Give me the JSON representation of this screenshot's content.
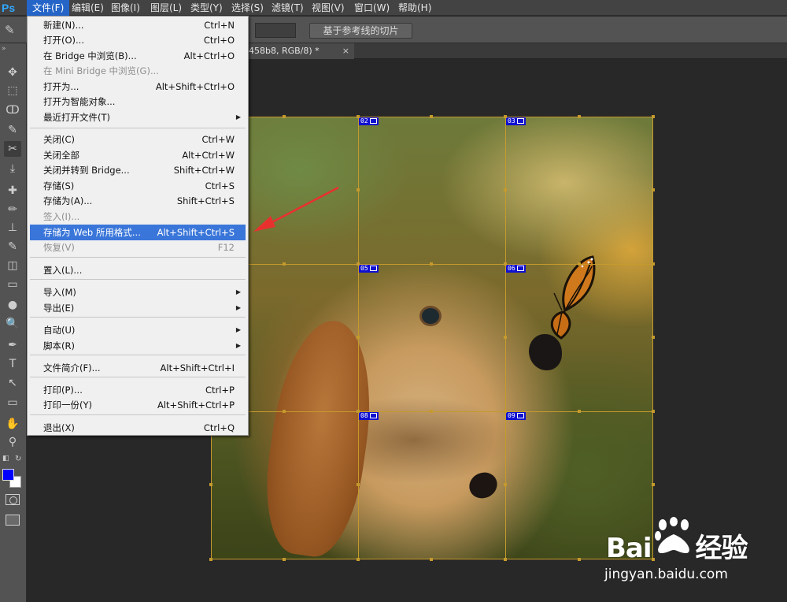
{
  "app": {
    "logo": "Ps"
  },
  "menubar": [
    {
      "label": "文件(F)",
      "active": true
    },
    {
      "label": "编辑(E)"
    },
    {
      "label": "图像(I)"
    },
    {
      "label": "图层(L)"
    },
    {
      "label": "类型(Y)"
    },
    {
      "label": "选择(S)"
    },
    {
      "label": "滤镜(T)"
    },
    {
      "label": "视图(V)"
    },
    {
      "label": "窗口(W)"
    },
    {
      "label": "帮助(H)"
    }
  ],
  "options_bar": {
    "guides_button": "基于参考线的切片"
  },
  "document_tab": {
    "title": "458b8, RGB/8) *",
    "close": "×"
  },
  "file_menu": {
    "items": [
      {
        "label": "新建(N)...",
        "shortcut": "Ctrl+N"
      },
      {
        "label": "打开(O)...",
        "shortcut": "Ctrl+O"
      },
      {
        "label": "在 Bridge 中浏览(B)...",
        "shortcut": "Alt+Ctrl+O"
      },
      {
        "label": "在 Mini Bridge 中浏览(G)...",
        "shortcut": "",
        "disabled": true
      },
      {
        "label": "打开为...",
        "shortcut": "Alt+Shift+Ctrl+O"
      },
      {
        "label": "打开为智能对象...",
        "shortcut": ""
      },
      {
        "label": "最近打开文件(T)",
        "shortcut": "",
        "submenu": true
      },
      {
        "label": "关闭(C)",
        "shortcut": "Ctrl+W"
      },
      {
        "label": "关闭全部",
        "shortcut": "Alt+Ctrl+W"
      },
      {
        "label": "关闭并转到 Bridge...",
        "shortcut": "Shift+Ctrl+W"
      },
      {
        "label": "存储(S)",
        "shortcut": "Ctrl+S"
      },
      {
        "label": "存储为(A)...",
        "shortcut": "Shift+Ctrl+S"
      },
      {
        "label": "签入(I)...",
        "shortcut": "",
        "disabled": true
      },
      {
        "label": "存储为 Web 所用格式...",
        "shortcut": "Alt+Shift+Ctrl+S",
        "highlighted": true
      },
      {
        "label": "恢复(V)",
        "shortcut": "F12",
        "disabled": true
      },
      {
        "label": "置入(L)...",
        "shortcut": ""
      },
      {
        "label": "导入(M)",
        "shortcut": "",
        "submenu": true
      },
      {
        "label": "导出(E)",
        "shortcut": "",
        "submenu": true
      },
      {
        "label": "自动(U)",
        "shortcut": "",
        "submenu": true
      },
      {
        "label": "脚本(R)",
        "shortcut": "",
        "submenu": true
      },
      {
        "label": "文件简介(F)...",
        "shortcut": "Alt+Shift+Ctrl+I"
      },
      {
        "label": "打印(P)...",
        "shortcut": "Ctrl+P"
      },
      {
        "label": "打印一份(Y)",
        "shortcut": "Alt+Shift+Ctrl+P"
      },
      {
        "label": "退出(X)",
        "shortcut": "Ctrl+Q"
      }
    ],
    "submenu_glyph": "▶"
  },
  "slices": [
    {
      "label": "02"
    },
    {
      "label": "03"
    },
    {
      "label": "05"
    },
    {
      "label": "06"
    },
    {
      "label": "08"
    },
    {
      "label": "09"
    }
  ],
  "colors": {
    "foreground": "#0000ff",
    "background": "#ffffff",
    "highlight": "#3a76d9",
    "slice_line": "#c59a2d",
    "arrow": "#e8312f"
  },
  "tools": [
    "move-icon",
    "marquee-icon",
    "lasso-icon",
    "quick-select-icon",
    "slice-icon",
    "eyedropper-icon",
    "healing-icon",
    "brush-icon",
    "stamp-icon",
    "history-brush-icon",
    "eraser-icon",
    "gradient-icon",
    "blur-icon",
    "dodge-icon",
    "pen-icon",
    "type-icon",
    "path-select-icon",
    "shape-icon",
    "hand-icon",
    "zoom-icon"
  ],
  "watermark": {
    "brand_left": "Bai",
    "brand_right": "经验",
    "url": "jingyan.baidu.com"
  }
}
